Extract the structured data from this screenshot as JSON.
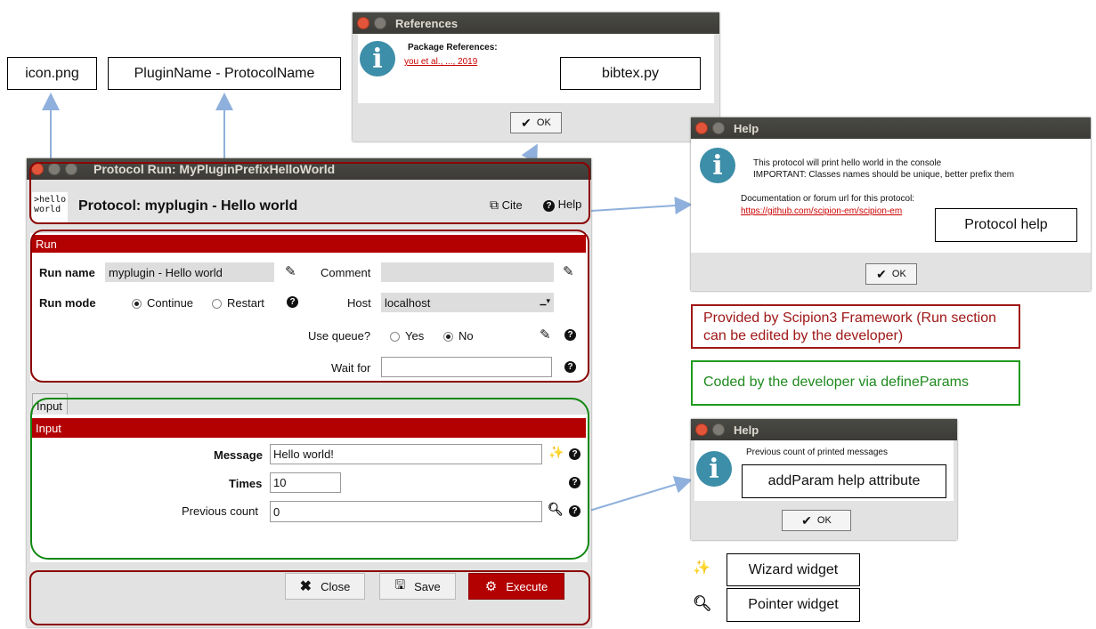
{
  "callouts": {
    "icon_png": "icon.png",
    "plugin_protocol_name": "PluginName - ProtocolName",
    "bibtex": "bibtex.py",
    "protocol_help": "Protocol help",
    "framework_note": "Provided by Scipion3 Framework (Run section can be edited by the developer)",
    "defineparams_note": "Coded by the developer via defineParams",
    "addparam_help": "addParam help attribute",
    "wizard_widget": "Wizard widget",
    "pointer_widget": "Pointer widget"
  },
  "references_dialog": {
    "title": "References",
    "heading": "Package References:",
    "link": "you et al., ..., 2019",
    "ok": "OK"
  },
  "help_dialog_1": {
    "title": "Help",
    "line1": "This protocol will print hello world in the console",
    "line2": "IMPORTANT: Classes names should be unique, better prefix them",
    "line3": "Documentation or forum url for this protocol:",
    "link": "https://github.com/scipion-em/scipion-em",
    "ok": "OK"
  },
  "help_dialog_2": {
    "title": "Help",
    "text": "Previous count of printed messages",
    "ok": "OK"
  },
  "main_window": {
    "title": "Protocol Run: MyPluginPrefixHelloWorld",
    "logo_line1": ">hello",
    "logo_line2": "world",
    "header": "Protocol: myplugin - Hello world",
    "cite": "Cite",
    "help": "Help",
    "run_section": "Run",
    "run_name_label": "Run name",
    "run_name_value": "myplugin - Hello world",
    "comment_label": "Comment",
    "comment_value": "",
    "run_mode_label": "Run mode",
    "run_mode_continue": "Continue",
    "run_mode_restart": "Restart",
    "run_mode_selected": "Continue",
    "host_label": "Host",
    "host_value": "localhost",
    "use_queue_label": "Use queue?",
    "queue_yes": "Yes",
    "queue_no": "No",
    "queue_selected": "No",
    "wait_for_label": "Wait for",
    "wait_for_value": "",
    "tab_input": "Input",
    "input_section": "Input",
    "message_label": "Message",
    "message_value": "Hello world!",
    "times_label": "Times",
    "times_value": "10",
    "previous_count_label": "Previous count",
    "previous_count_value": "0",
    "close": "Close",
    "save": "Save",
    "execute": "Execute"
  },
  "colors": {
    "accent_red": "#b30000",
    "frame_red": "#8b0000",
    "frame_green": "#118811",
    "info_blue": "#3d8ea8",
    "arrow_blue": "#8fb0dc"
  }
}
